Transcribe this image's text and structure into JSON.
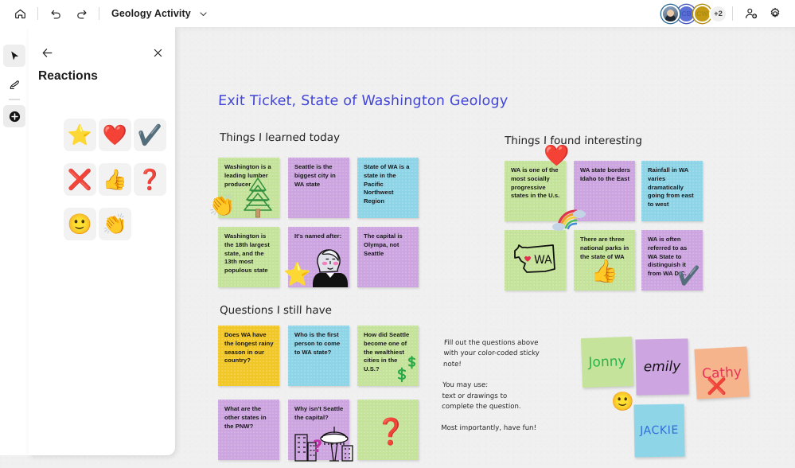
{
  "topbar": {
    "home_label": "Home",
    "undo_label": "Undo",
    "redo_label": "Redo",
    "doc_title": "Geology Activity",
    "chevron": "chevron-down",
    "presence_overflow": "+2",
    "collaborators": [
      {
        "initials": "",
        "name": "collaborator-photo",
        "color": "#6d7f96"
      },
      {
        "initials": "CB",
        "name": "collaborator-cb",
        "color": "#5b6fd6"
      },
      {
        "initials": "CW",
        "name": "collaborator-cw",
        "color": "#c49a14"
      }
    ],
    "share_label": "Share",
    "settings_label": "Settings"
  },
  "rail": {
    "items": [
      {
        "name": "select-tool",
        "label": "Select",
        "selected": true
      },
      {
        "name": "pen-tool",
        "label": "Ink",
        "selected": false
      },
      {
        "name": "add-tool",
        "label": "Create",
        "selected": false
      }
    ]
  },
  "panel": {
    "back_label": "Back",
    "close_label": "Close",
    "title": "Reactions",
    "reactions": [
      {
        "name": "reaction-star",
        "glyph": "⭐",
        "label": "Star"
      },
      {
        "name": "reaction-heart",
        "glyph": "❤️",
        "label": "Heart"
      },
      {
        "name": "reaction-check",
        "glyph": "✔️",
        "label": "Check mark"
      },
      {
        "name": "reaction-cross",
        "glyph": "❌",
        "label": "Cross mark"
      },
      {
        "name": "reaction-thumbsup",
        "glyph": "👍",
        "label": "Thumbs up"
      },
      {
        "name": "reaction-question",
        "glyph": "❓",
        "label": "Question mark"
      },
      {
        "name": "reaction-smile",
        "glyph": "🙂",
        "label": "Smiley"
      },
      {
        "name": "reaction-clap",
        "glyph": "👏",
        "label": "Clapping hands"
      }
    ]
  },
  "board": {
    "title": "Exit Ticket, State of Washington Geology",
    "sections": [
      {
        "name": "section-learned",
        "heading": "Things I learned today"
      },
      {
        "name": "section-interesting",
        "heading": "Things I found interesting"
      },
      {
        "name": "section-questions",
        "heading": "Questions I still have"
      }
    ],
    "instructions": "Fill out the questions above\nwith your color-coded sticky\nnote!\n\nYou may use:\ntext or drawings to\ncomplete the question.\n\nMost importantly, have fun!",
    "colors": {
      "green": "#c5e39a",
      "purple": "#cda5e0",
      "blue": "#8fd5e8",
      "yellow": "#f2c829",
      "peach": "#f5b48c",
      "title_blue": "#4245d6"
    },
    "notes_learned": [
      {
        "text": "Washington is a leading lumber producer",
        "color": "green"
      },
      {
        "text": "Seattle is the biggest city in WA state",
        "color": "purple"
      },
      {
        "text": "State of WA is a state in the Pacific Northwest Region",
        "color": "blue"
      },
      {
        "text": "Washington is the 18th largest state, and the 13th most populous state",
        "color": "green"
      },
      {
        "text": "It's named after:",
        "color": "purple"
      },
      {
        "text": "The capital is Olympa, not Seattle",
        "color": "purple"
      }
    ],
    "notes_interesting": [
      {
        "text": "WA is one of the most socially progressive states in the U.s.",
        "color": "green"
      },
      {
        "text": "WA state borders Idaho to the East",
        "color": "purple"
      },
      {
        "text": "Rainfall in WA varies dramatically going from east to west",
        "color": "blue"
      },
      {
        "text": "",
        "color": "green"
      },
      {
        "text": "There are three national parks in the state of WA",
        "color": "green"
      },
      {
        "text": "WA is often referred to as WA State to distinguish it from WA D.C.",
        "color": "purple"
      }
    ],
    "notes_questions": [
      {
        "text": "Does WA have the longest rainy season in our country?",
        "color": "yellow"
      },
      {
        "text": "Who is the first person to come to WA state?",
        "color": "blue"
      },
      {
        "text": "How did Seattle become one of the wealthiest cities in the U.S.?",
        "color": "green"
      },
      {
        "text": "What are the other states in the PNW?",
        "color": "purple"
      },
      {
        "text": "Why isn't Seattle the capital?",
        "color": "purple"
      },
      {
        "text": "",
        "color": "green"
      }
    ],
    "name_notes": [
      {
        "name": "sticky-name-jonny",
        "text": "Jonny",
        "color": "green",
        "ink": "#2bb24c"
      },
      {
        "name": "sticky-name-emily",
        "text": "emily",
        "color": "purple",
        "ink": "#141414"
      },
      {
        "name": "sticky-name-cathy",
        "text": "Cathy",
        "color": "peach",
        "ink": "#e83458"
      },
      {
        "name": "sticky-name-jackie",
        "text": "JACKIE",
        "color": "blue",
        "ink": "#2f6ed8"
      }
    ],
    "canvas_stickers": [
      {
        "name": "sticker-clap",
        "glyph": "👏"
      },
      {
        "name": "sticker-star",
        "glyph": "⭐"
      },
      {
        "name": "sticker-heart",
        "glyph": "❤️"
      },
      {
        "name": "sticker-thumbsup",
        "glyph": "👍"
      },
      {
        "name": "sticker-check",
        "glyph": "✔️"
      },
      {
        "name": "sticker-smile",
        "glyph": "🙂"
      },
      {
        "name": "sticker-cross",
        "glyph": "❌"
      },
      {
        "name": "sticker-question-pink",
        "glyph": "❓"
      }
    ],
    "drawings": [
      {
        "name": "drawing-pine-tree"
      },
      {
        "name": "drawing-george-washington"
      },
      {
        "name": "drawing-rainbow"
      },
      {
        "name": "drawing-wa-map"
      },
      {
        "name": "drawing-dollar-signs"
      },
      {
        "name": "drawing-seattle-skyline"
      }
    ]
  }
}
